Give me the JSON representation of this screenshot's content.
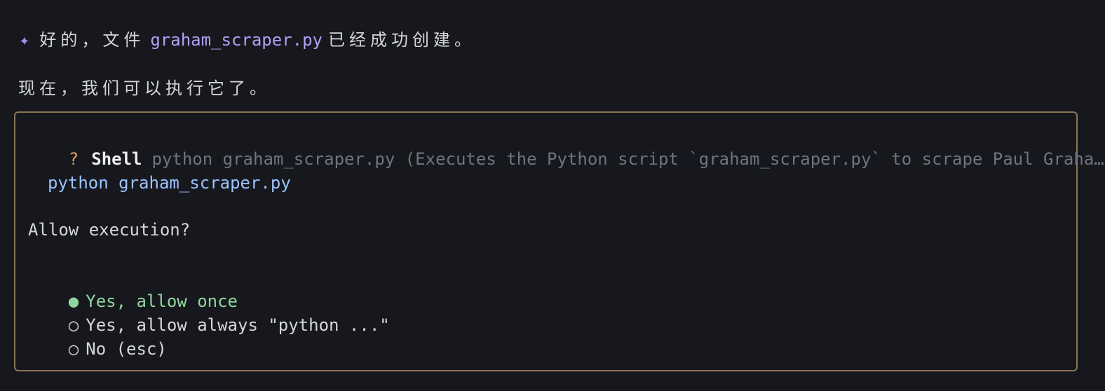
{
  "message": {
    "sparkle": "✦",
    "prefix": "好的，文件",
    "filename": "graham_scraper.py",
    "suffix": "已经成功创建。",
    "followup": "现在，我们可以执行它了。"
  },
  "prompt": {
    "question_mark": "?",
    "tool_name": "Shell",
    "tool_description": "python graham_scraper.py (Executes the Python script `graham_scraper.py` to scrape Paul Graha…",
    "return_arrow": "←",
    "command": "python graham_scraper.py",
    "question": "Allow execution?",
    "options": [
      {
        "indicator": "●",
        "label": "Yes, allow once"
      },
      {
        "indicator": "○",
        "label": "Yes, allow always \"python ...\""
      },
      {
        "indicator": "○",
        "label": "No (esc)"
      }
    ]
  },
  "colors": {
    "background": "#16181d",
    "border": "#8a7558",
    "accent_purple": "#b49ff5",
    "command_blue": "#9cc2ff",
    "selected_green": "#8fd79e",
    "question_orange": "#d8a05a"
  }
}
